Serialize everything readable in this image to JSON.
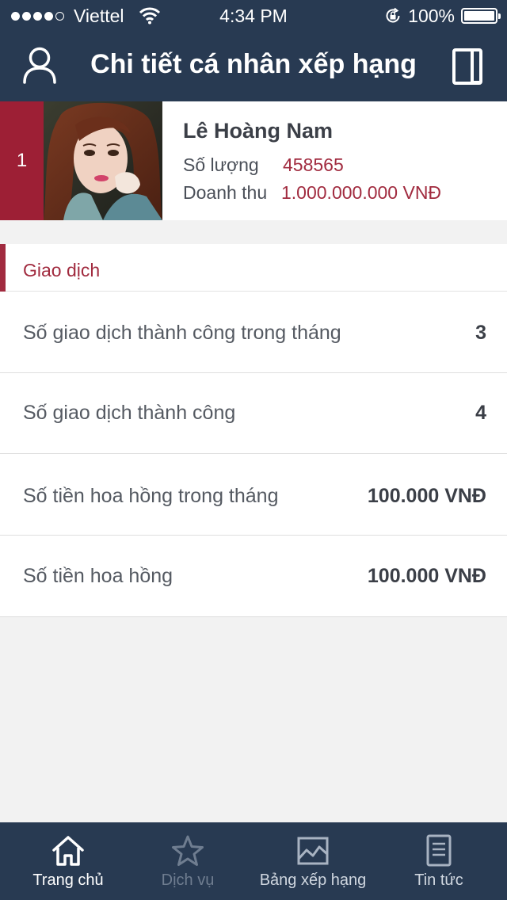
{
  "status_bar": {
    "carrier": "Viettel",
    "time": "4:34 PM",
    "battery": "100%"
  },
  "header": {
    "title": "Chi tiết cá nhân xếp hạng"
  },
  "profile": {
    "rank": "1",
    "name": "Lê Hoàng Nam",
    "quantity_label": "Số lượng",
    "quantity_value": "458565",
    "revenue_label": "Doanh thu",
    "revenue_value": "1.000.000.000 VNĐ"
  },
  "section": {
    "title": "Giao dịch",
    "rows": [
      {
        "label": "Số giao dịch thành công trong tháng",
        "value": "3"
      },
      {
        "label": "Số giao dịch thành công",
        "value": "4"
      },
      {
        "label": "Số tiền hoa hồng trong tháng",
        "value": "100.000 VNĐ"
      },
      {
        "label": "Số tiền hoa hồng",
        "value": "100.000 VNĐ"
      }
    ]
  },
  "tabs": [
    {
      "label": "Trang chủ",
      "icon": "home-icon",
      "active": true
    },
    {
      "label": "Dịch vụ",
      "icon": "star-icon",
      "active": false
    },
    {
      "label": "Bảng xếp hạng",
      "icon": "chart-icon",
      "active": false
    },
    {
      "label": "Tin tức",
      "icon": "document-icon",
      "active": false
    }
  ],
  "colors": {
    "nav_bg": "#283a52",
    "accent": "#a12b3f",
    "rank_bg": "#9d1f35",
    "page_bg": "#f2f2f2",
    "tab_active": "#ffffff",
    "tab_dim": "#6f7d90"
  }
}
